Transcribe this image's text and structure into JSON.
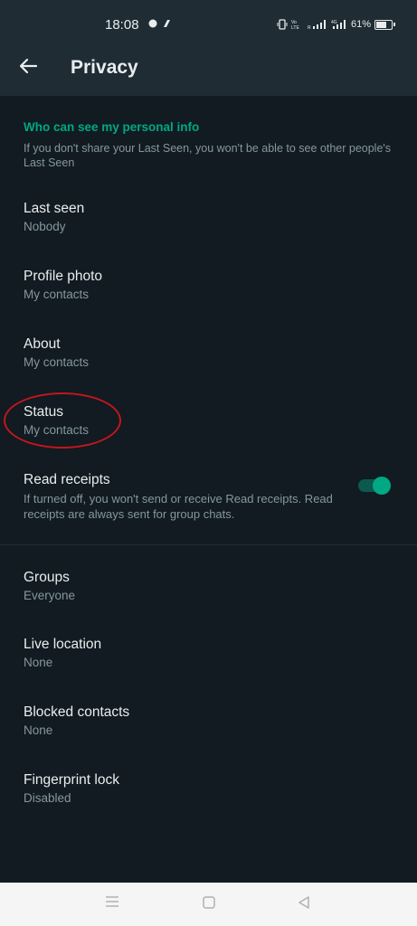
{
  "status_bar": {
    "time": "18:08",
    "app_icons": "⬤ ⬤",
    "battery": "61%"
  },
  "app_bar": {
    "title": "Privacy",
    "back_icon": "arrow-left"
  },
  "section": {
    "heading": "Who can see my personal info",
    "description": "If you don't share your Last Seen, you won't be able to see other people's Last Seen"
  },
  "settings": [
    {
      "label": "Last seen",
      "value": "Nobody"
    },
    {
      "label": "Profile photo",
      "value": "My contacts"
    },
    {
      "label": "About",
      "value": "My contacts"
    },
    {
      "label": "Status",
      "value": "My contacts"
    }
  ],
  "read_receipts": {
    "label": "Read receipts",
    "description": "If turned off, you won't send or receive Read receipts. Read receipts are always sent for group chats.",
    "enabled": true
  },
  "settings2": [
    {
      "label": "Groups",
      "value": "Everyone"
    },
    {
      "label": "Live location",
      "value": "None"
    },
    {
      "label": "Blocked contacts",
      "value": "None"
    },
    {
      "label": "Fingerprint lock",
      "value": "Disabled"
    }
  ],
  "colors": {
    "background": "#111b21",
    "accent": "#00a884",
    "annotation": "#c4161c"
  }
}
